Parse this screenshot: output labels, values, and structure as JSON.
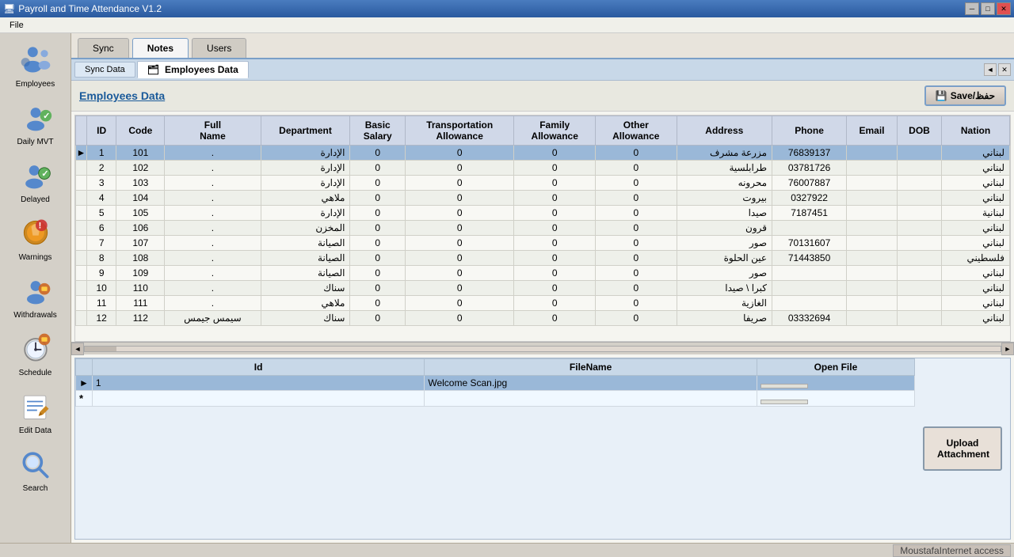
{
  "titlebar": {
    "title": "Payroll and Time Attendance V1.2",
    "buttons": {
      "minimize": "─",
      "maximize": "□",
      "close": "✕"
    }
  },
  "menubar": {
    "items": [
      "File"
    ]
  },
  "sidebar": {
    "items": [
      {
        "id": "employees",
        "label": "Employees",
        "icon": "employees-icon"
      },
      {
        "id": "daily-mvt",
        "label": "Daily MVT",
        "icon": "daily-mvt-icon"
      },
      {
        "id": "delayed",
        "label": "Delayed",
        "icon": "delayed-icon"
      },
      {
        "id": "warnings",
        "label": "Warnings",
        "icon": "warnings-icon"
      },
      {
        "id": "withdrawals",
        "label": "Withdrawals",
        "icon": "withdrawals-icon"
      },
      {
        "id": "schedule",
        "label": "Schedule",
        "icon": "schedule-icon"
      },
      {
        "id": "edit-data",
        "label": "Edit Data",
        "icon": "edit-data-icon"
      },
      {
        "id": "search",
        "label": "Search",
        "icon": "search-icon"
      }
    ]
  },
  "tabs": {
    "items": [
      {
        "id": "sync",
        "label": "Sync"
      },
      {
        "id": "notes",
        "label": "Notes"
      },
      {
        "id": "users",
        "label": "Users"
      }
    ],
    "active": "notes"
  },
  "subtabs": {
    "items": [
      {
        "id": "sync-data",
        "label": "Sync Data"
      },
      {
        "id": "employees-data",
        "label": "Employees Data"
      }
    ],
    "active": "employees-data"
  },
  "section": {
    "title": "Employees Data",
    "save_button": "Save/حفظ"
  },
  "table": {
    "columns": [
      {
        "id": "id",
        "label": "ID"
      },
      {
        "id": "code",
        "label": "Code"
      },
      {
        "id": "full-name",
        "label": "Full Name"
      },
      {
        "id": "department",
        "label": "Department"
      },
      {
        "id": "basic-salary",
        "label": "Basic Salary"
      },
      {
        "id": "transport-allowance",
        "label": "Transportation Allowance"
      },
      {
        "id": "family-allowance",
        "label": "Family Allowance"
      },
      {
        "id": "other-allowance",
        "label": "Other Allowance"
      },
      {
        "id": "address",
        "label": "Address"
      },
      {
        "id": "phone",
        "label": "Phone"
      },
      {
        "id": "email",
        "label": "Email"
      },
      {
        "id": "dob",
        "label": "DOB"
      },
      {
        "id": "nation",
        "label": "Nation"
      }
    ],
    "rows": [
      {
        "id": 1,
        "code": 101,
        "fullName": ".",
        "department": "الإدارة",
        "basicSalary": 0,
        "transportAllowance": 0,
        "familyAllowance": 0,
        "otherAllowance": 0,
        "address": "مزرعة مشرف",
        "phone": "76839137",
        "email": "",
        "dob": "",
        "nation": "لبناني",
        "selected": true
      },
      {
        "id": 2,
        "code": 102,
        "fullName": ".",
        "department": "الإدارة",
        "basicSalary": 0,
        "transportAllowance": 0,
        "familyAllowance": 0,
        "otherAllowance": 0,
        "address": "طرابلسية",
        "phone": "03781726",
        "email": "",
        "dob": "",
        "nation": "لبناني",
        "selected": false
      },
      {
        "id": 3,
        "code": 103,
        "fullName": ".",
        "department": "الإدارة",
        "basicSalary": 0,
        "transportAllowance": 0,
        "familyAllowance": 0,
        "otherAllowance": 0,
        "address": "محرونه",
        "phone": "76007887",
        "email": "",
        "dob": "",
        "nation": "لبناني",
        "selected": false
      },
      {
        "id": 4,
        "code": 104,
        "fullName": ".",
        "department": "ملاهي",
        "basicSalary": 0,
        "transportAllowance": 0,
        "familyAllowance": 0,
        "otherAllowance": 0,
        "address": "بيروت",
        "phone": "0327922",
        "email": "",
        "dob": "",
        "nation": "لبناني",
        "selected": false
      },
      {
        "id": 5,
        "code": 105,
        "fullName": ".",
        "department": "الإدارة",
        "basicSalary": 0,
        "transportAllowance": 0,
        "familyAllowance": 0,
        "otherAllowance": 0,
        "address": "صيدا",
        "phone": "7187451",
        "email": "",
        "dob": "",
        "nation": "لبنانية",
        "selected": false
      },
      {
        "id": 6,
        "code": 106,
        "fullName": ".",
        "department": "المخزن",
        "basicSalary": 0,
        "transportAllowance": 0,
        "familyAllowance": 0,
        "otherAllowance": 0,
        "address": "قرون",
        "phone": "",
        "email": "",
        "dob": "",
        "nation": "لبناني",
        "selected": false
      },
      {
        "id": 7,
        "code": 107,
        "fullName": ".",
        "department": "الصيانة",
        "basicSalary": 0,
        "transportAllowance": 0,
        "familyAllowance": 0,
        "otherAllowance": 0,
        "address": "صور",
        "phone": "70131607",
        "email": "",
        "dob": "",
        "nation": "لبناني",
        "selected": false
      },
      {
        "id": 8,
        "code": 108,
        "fullName": ".",
        "department": "الصيانة",
        "basicSalary": 0,
        "transportAllowance": 0,
        "familyAllowance": 0,
        "otherAllowance": 0,
        "address": "عين الحلوة",
        "phone": "71443850",
        "email": "",
        "dob": "",
        "nation": "فلسطيني",
        "selected": false
      },
      {
        "id": 9,
        "code": 109,
        "fullName": ".",
        "department": "الصيانة",
        "basicSalary": 0,
        "transportAllowance": 0,
        "familyAllowance": 0,
        "otherAllowance": 0,
        "address": "صور",
        "phone": "",
        "email": "",
        "dob": "",
        "nation": "لبناني",
        "selected": false
      },
      {
        "id": 10,
        "code": 110,
        "fullName": ".",
        "department": "سناك",
        "basicSalary": 0,
        "transportAllowance": 0,
        "familyAllowance": 0,
        "otherAllowance": 0,
        "address": "كبرا \\ صيدا",
        "phone": "",
        "email": "",
        "dob": "",
        "nation": "لبناني",
        "selected": false
      },
      {
        "id": 11,
        "code": 111,
        "fullName": ".",
        "department": "ملاهي",
        "basicSalary": 0,
        "transportAllowance": 0,
        "familyAllowance": 0,
        "otherAllowance": 0,
        "address": "الغازية",
        "phone": "",
        "email": "",
        "dob": "",
        "nation": "لبناني",
        "selected": false
      },
      {
        "id": 12,
        "code": 112,
        "fullName": "سيمس جيمس",
        "department": "سناك",
        "basicSalary": 0,
        "transportAllowance": 0,
        "familyAllowance": 0,
        "otherAllowance": 0,
        "address": "صريفا",
        "phone": "03332694",
        "email": "",
        "dob": "",
        "nation": "لبناني",
        "selected": false
      }
    ]
  },
  "attachments": {
    "columns": [
      {
        "id": "att-id",
        "label": "Id"
      },
      {
        "id": "att-filename",
        "label": "FileName"
      },
      {
        "id": "att-openfile",
        "label": "Open File"
      }
    ],
    "rows": [
      {
        "id": 1,
        "fileName": "Welcome Scan.jpg",
        "selected": true
      }
    ],
    "upload_button": "Upload Attachment"
  },
  "statusbar": {
    "user": "Moustafa",
    "connection": "Internet access"
  }
}
